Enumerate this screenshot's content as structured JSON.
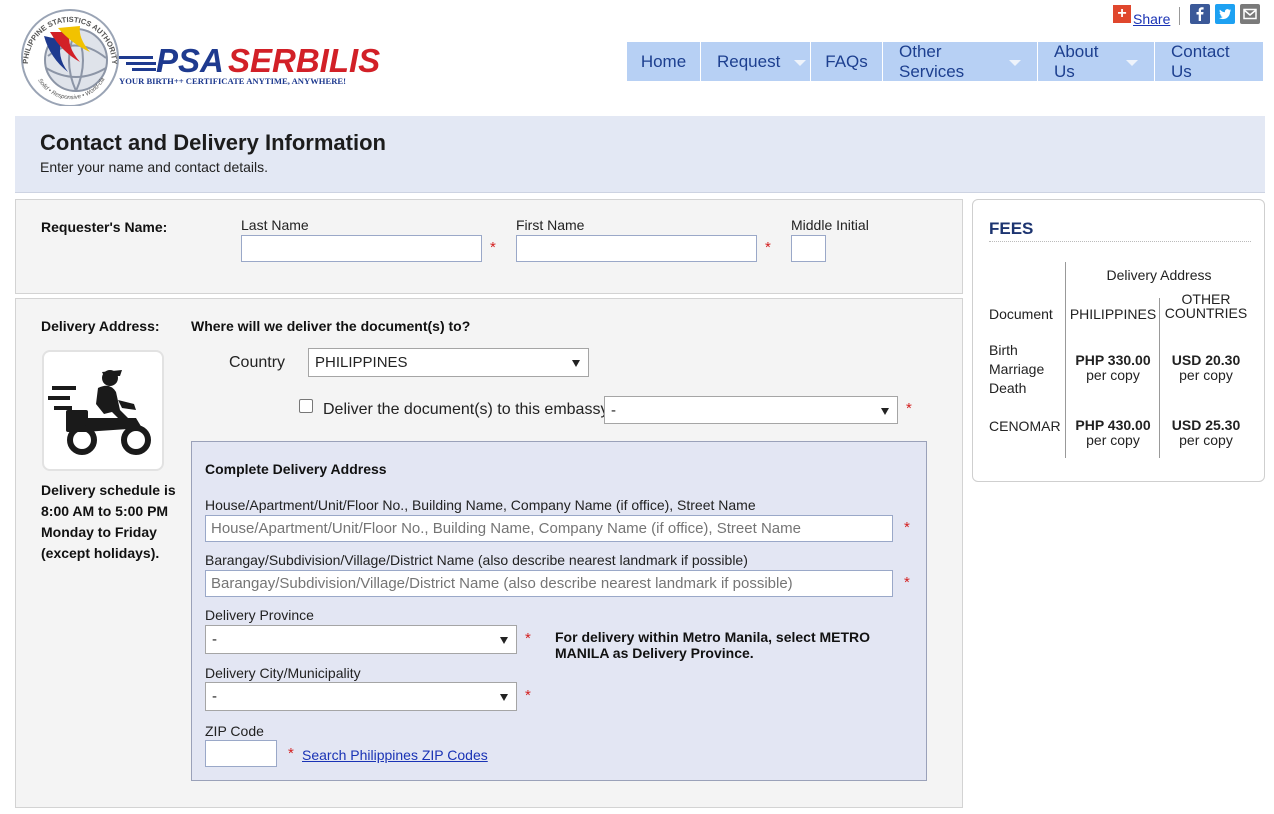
{
  "brand": {
    "seal_text": "PHILIPPINE STATISTICS AUTHORITY",
    "seal_motto": "Solid • Responsive • World-class",
    "name_part1": "PSA",
    "name_part2": "SERBILIS",
    "tagline": "YOUR BIRTH++ CERTIFICATE ANYTIME, ANYWHERE!",
    "colors": {
      "blue": "#1e3a8f",
      "red": "#d22027",
      "yellow": "#f2c200"
    }
  },
  "share": {
    "plus": "+",
    "label": "Share",
    "icons": [
      "facebook-icon",
      "twitter-icon",
      "email-icon"
    ]
  },
  "nav": [
    {
      "label": "Home",
      "dropdown": false
    },
    {
      "label": "Request",
      "dropdown": true
    },
    {
      "label": "FAQs",
      "dropdown": false
    },
    {
      "label": "Other Services",
      "dropdown": true
    },
    {
      "label": "About Us",
      "dropdown": true
    },
    {
      "label": "Contact Us",
      "dropdown": false
    }
  ],
  "page": {
    "title": "Contact and Delivery Information",
    "subtitle": "Enter your name and contact details."
  },
  "requester": {
    "label": "Requester's Name:",
    "last_name_label": "Last Name",
    "first_name_label": "First Name",
    "middle_initial_label": "Middle Initial",
    "last_name_value": "",
    "first_name_value": "",
    "middle_initial_value": "",
    "required_mark": "*"
  },
  "delivery": {
    "label": "Delivery Address:",
    "question": "Where will we deliver the document(s) to?",
    "country_label": "Country",
    "country_value": "PHILIPPINES",
    "embassy_checkbox_label": "Deliver the document(s) to this embassy",
    "embassy_checked": false,
    "embassy_value": "-",
    "schedule": "Delivery schedule is 8:00 AM to 5:00 PM Monday to Friday (except holidays).",
    "required_mark": "*"
  },
  "address": {
    "heading": "Complete Delivery Address",
    "house_label": "House/Apartment/Unit/Floor No., Building Name, Company Name (if office), Street Name",
    "house_placeholder": "House/Apartment/Unit/Floor No., Building Name, Company Name (if office), Street Name",
    "barangay_label": "Barangay/Subdivision/Village/District Name (also describe nearest landmark if possible)",
    "barangay_placeholder": "Barangay/Subdivision/Village/District Name (also describe nearest landmark if possible)",
    "province_label": "Delivery Province",
    "province_value": "-",
    "province_note": "For delivery within Metro Manila, select METRO MANILA as Delivery Province.",
    "city_label": "Delivery City/Municipality",
    "city_value": "-",
    "zip_label": "ZIP Code",
    "zip_value": "",
    "zip_link": "Search Philippines ZIP Codes",
    "required_mark": "*"
  },
  "fees": {
    "title": "FEES",
    "delivery_address_header": "Delivery Address",
    "document_header": "Document",
    "ph_header": "PHILIPPINES",
    "other_header": "OTHER COUNTRIES",
    "rows": [
      {
        "docs": [
          "Birth",
          "Marriage",
          "Death"
        ],
        "ph_price": "PHP 330.00",
        "other_price": "USD 20.30",
        "unit": "per copy"
      },
      {
        "docs": [
          "CENOMAR"
        ],
        "ph_price": "PHP 430.00",
        "other_price": "USD 25.30",
        "unit": "per copy"
      }
    ]
  }
}
